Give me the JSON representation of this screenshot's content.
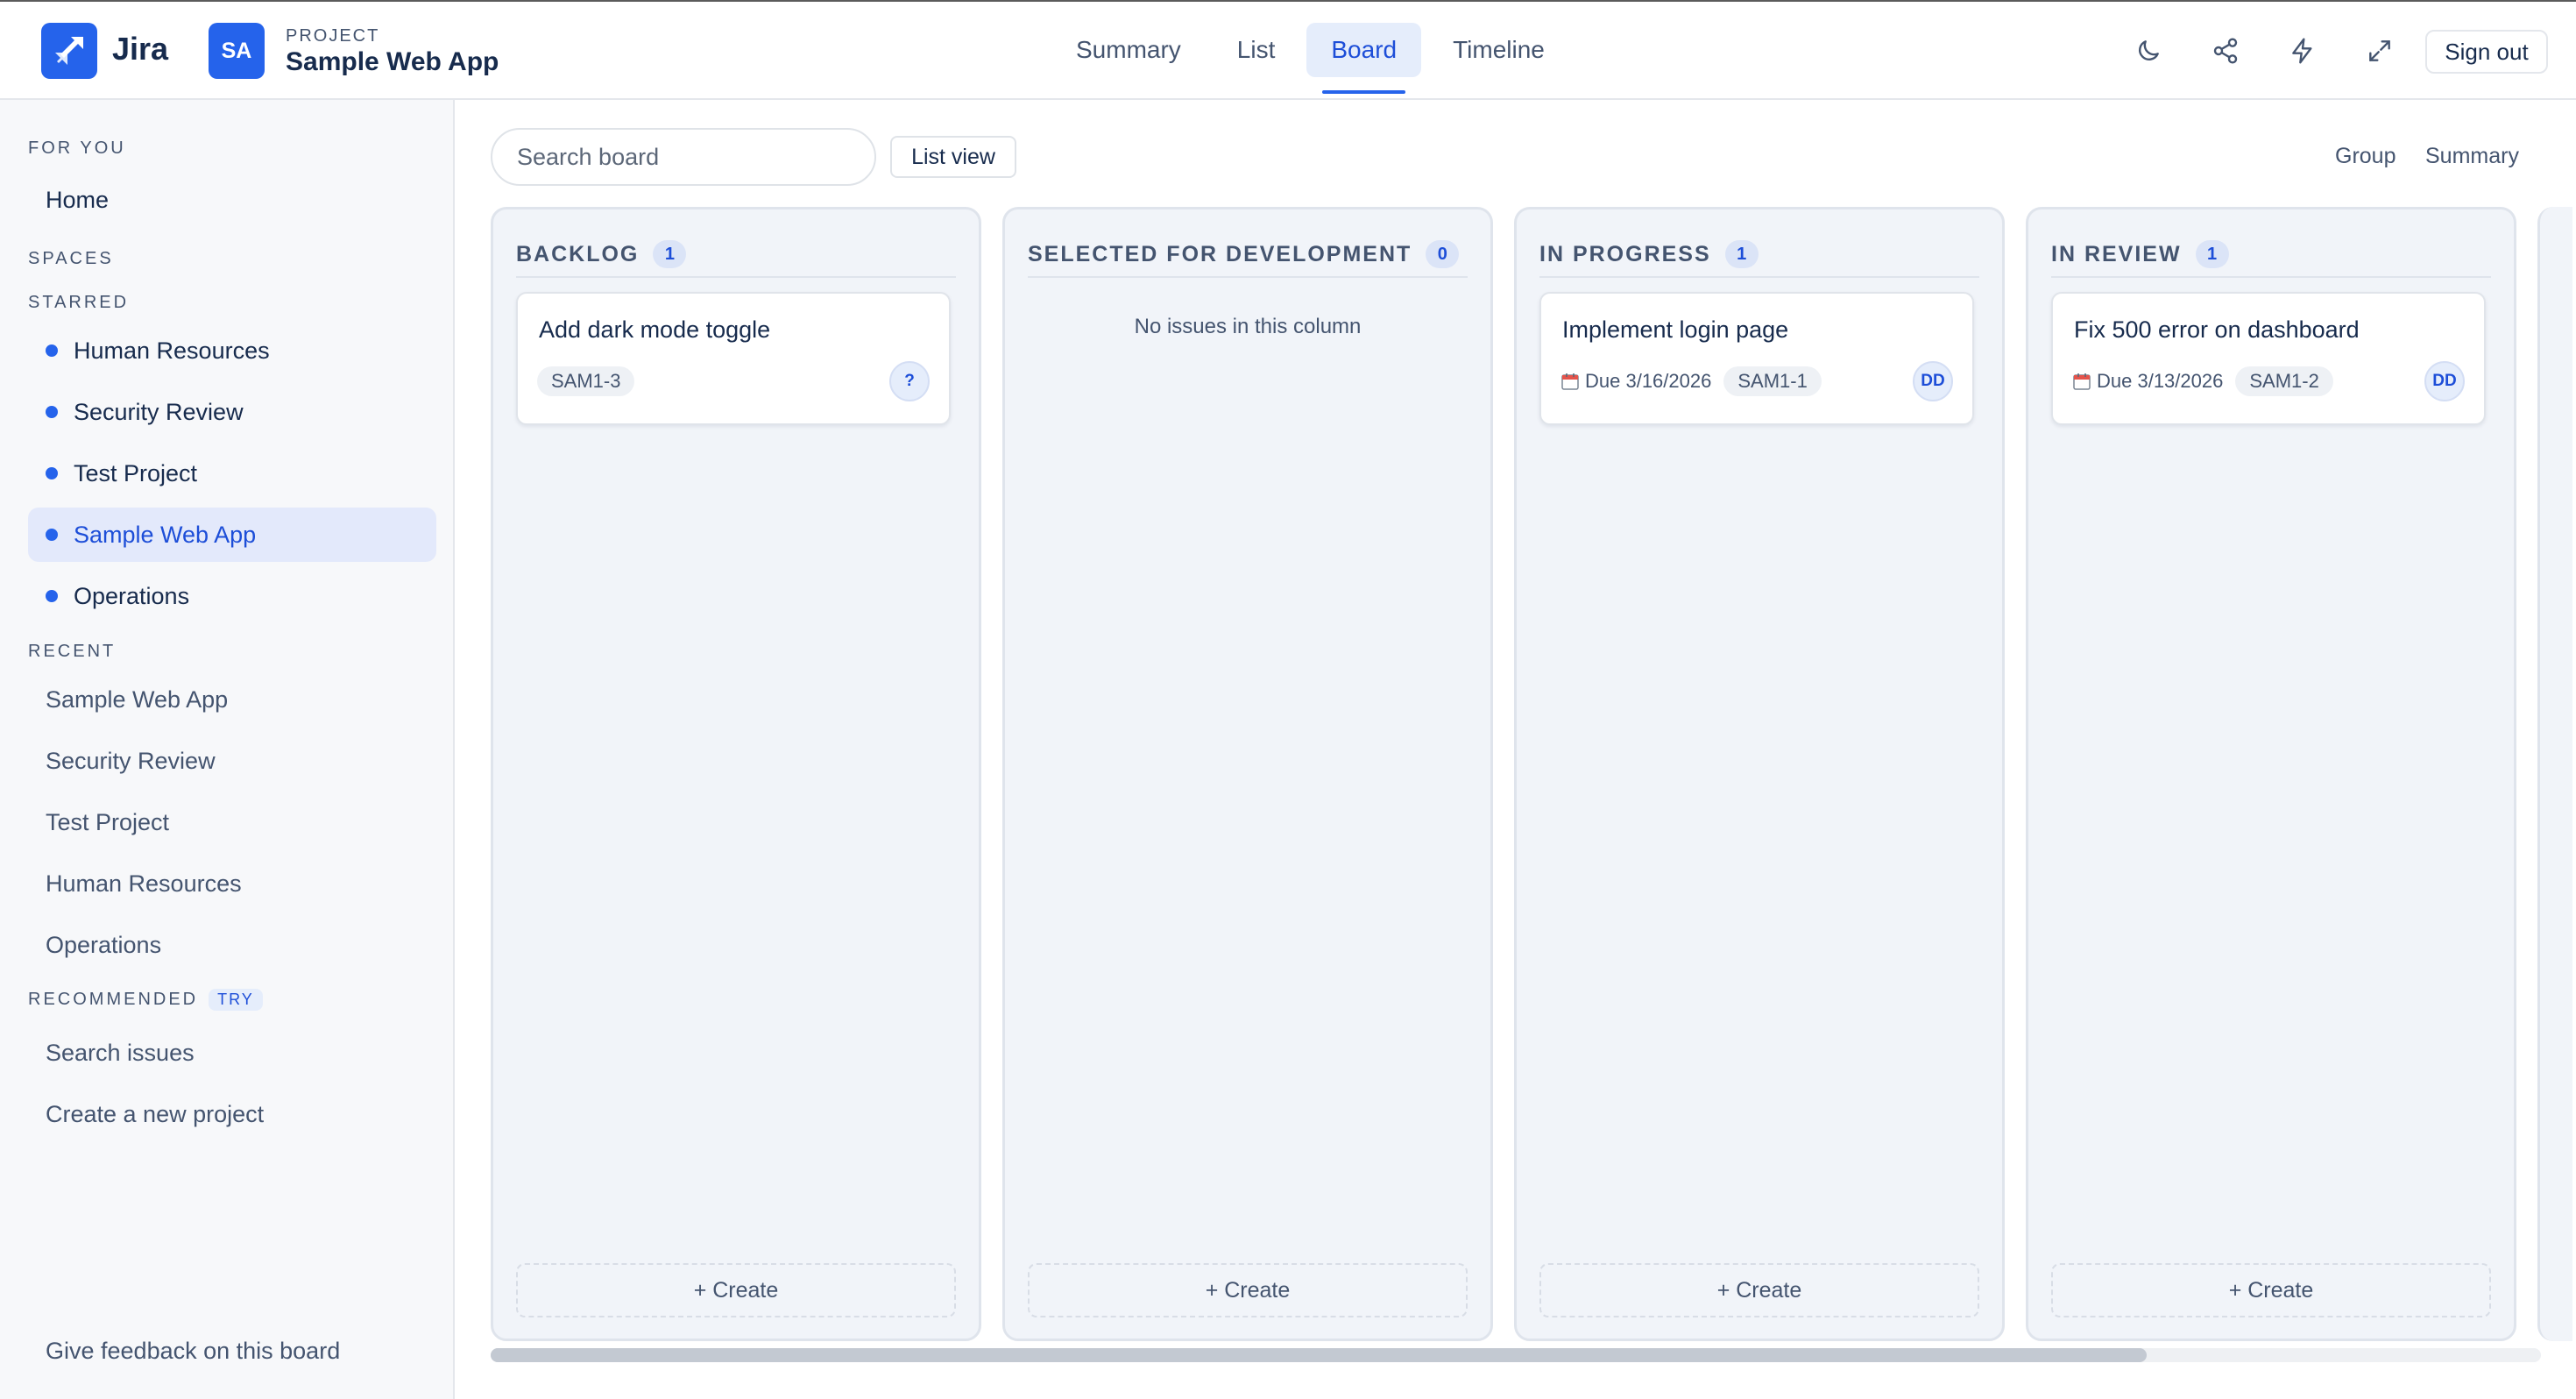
{
  "app": {
    "name": "Jira"
  },
  "project": {
    "kicker": "PROJECT",
    "avatar": "SA",
    "name": "Sample Web App"
  },
  "tabs": [
    {
      "label": "Summary",
      "active": false
    },
    {
      "label": "List",
      "active": false
    },
    {
      "label": "Board",
      "active": true
    },
    {
      "label": "Timeline",
      "active": false
    }
  ],
  "toolbar_icons": [
    "moon-icon",
    "share-icon",
    "lightning-icon",
    "expand-icon"
  ],
  "signout_label": "Sign out",
  "sidebar": {
    "for_you_heading": "FOR YOU",
    "home": "Home",
    "spaces_heading": "SPACES",
    "starred_heading": "STARRED",
    "starred": [
      "Human Resources",
      "Security Review",
      "Test Project",
      "Sample Web App",
      "Operations"
    ],
    "active_starred": "Sample Web App",
    "recent_heading": "RECENT",
    "recent": [
      "Sample Web App",
      "Security Review",
      "Test Project",
      "Human Resources",
      "Operations"
    ],
    "recommended_heading": "RECOMMENDED",
    "try_badge": "TRY",
    "recommended": [
      "Search issues",
      "Create a new project"
    ],
    "feedback": "Give feedback on this board"
  },
  "board": {
    "search_placeholder": "Search board",
    "list_view_label": "List view",
    "group_label": "Group",
    "summary_label": "Summary",
    "empty_text": "No issues in this column",
    "create_label": "+ Create",
    "columns": [
      {
        "title": "BACKLOG",
        "count": "1",
        "cards": [
          {
            "title": "Add dark mode toggle",
            "due": "",
            "key": "SAM1-3",
            "assignee": "?"
          }
        ]
      },
      {
        "title": "SELECTED FOR DEVELOPMENT",
        "count": "0",
        "cards": []
      },
      {
        "title": "IN PROGRESS",
        "count": "1",
        "cards": [
          {
            "title": "Implement login page",
            "due": "Due 3/16/2026",
            "key": "SAM1-1",
            "assignee": "DD"
          }
        ]
      },
      {
        "title": "IN REVIEW",
        "count": "1",
        "cards": [
          {
            "title": "Fix 500 error on dashboard",
            "due": "Due 3/13/2026",
            "key": "SAM1-2",
            "assignee": "DD"
          }
        ]
      }
    ]
  },
  "colors": {
    "accent": "#2563eb",
    "accent_soft": "#e5edfb",
    "column_bg": "#f1f4f9",
    "sidebar_bg": "#f7f8fa"
  }
}
